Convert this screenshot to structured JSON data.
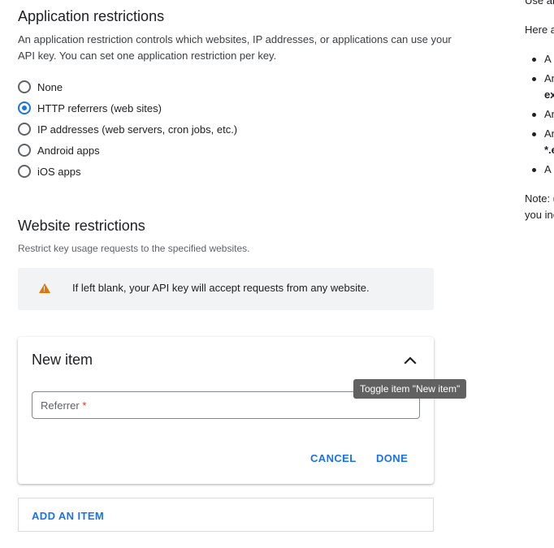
{
  "help_panel": {
    "line1": "Use ar",
    "line2": "Here a",
    "bullets": [
      "A",
      "An",
      "An",
      "An",
      "A"
    ],
    "bold_frag1": "ex",
    "bold_frag2": "*.e",
    "note1": "Note: (",
    "note2": "you inc"
  },
  "app_restrictions": {
    "title": "Application restrictions",
    "description_line1": "An application restriction controls which websites, IP addresses, or applications can use your",
    "description_line2": "API key. You can set one application restriction per key.",
    "options": [
      {
        "label": "None",
        "checked": false
      },
      {
        "label": "HTTP referrers (web sites)",
        "checked": true
      },
      {
        "label": "IP addresses (web servers, cron jobs, etc.)",
        "checked": false
      },
      {
        "label": "Android apps",
        "checked": false
      },
      {
        "label": "iOS apps",
        "checked": false
      }
    ]
  },
  "website_restrictions": {
    "title": "Website restrictions",
    "subtitle": "Restrict key usage requests to the specified websites.",
    "warning": "If left blank, your API key will accept requests from any website.",
    "warning_icon": "warning-icon"
  },
  "new_item_card": {
    "title": "New item",
    "toggle_icon": "chevron-up-icon",
    "tooltip": "Toggle item \"New item\"",
    "referrer_label": "Referrer",
    "required_mark": "*",
    "cancel_label": "CANCEL",
    "done_label": "DONE"
  },
  "add_item": {
    "label": "ADD AN ITEM"
  },
  "colors": {
    "accent": "#1a73e8",
    "warning": "#e37400",
    "tooltip_bg": "#616161"
  }
}
